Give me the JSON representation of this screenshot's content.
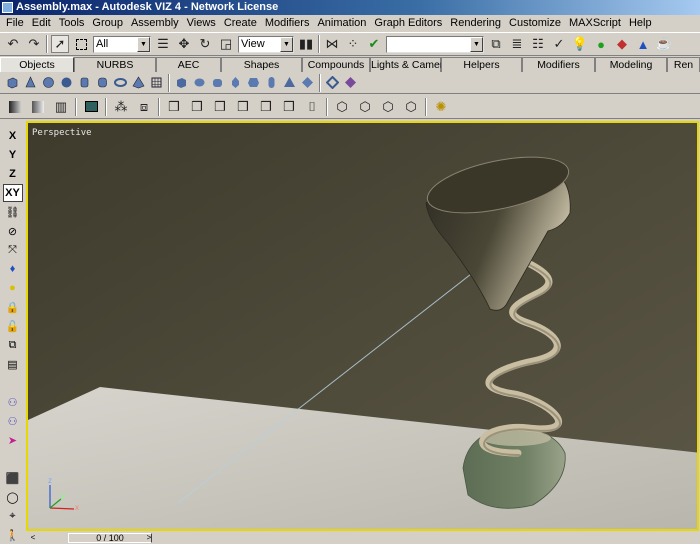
{
  "window": {
    "title": "Assembly.max - Autodesk VIZ 4 - Network License"
  },
  "menu": [
    "File",
    "Edit",
    "Tools",
    "Group",
    "Assembly",
    "Views",
    "Create",
    "Modifiers",
    "Animation",
    "Graph Editors",
    "Rendering",
    "Customize",
    "MAXScript",
    "Help"
  ],
  "toolbar": {
    "selection_filter": "All",
    "ref_coord": "View",
    "named_selection": ""
  },
  "tabs": [
    {
      "label": "Objects",
      "active": true
    },
    {
      "label": "NURBS"
    },
    {
      "label": "AEC"
    },
    {
      "label": "Shapes"
    },
    {
      "label": "Compounds"
    },
    {
      "label": "Lights & Cameras"
    },
    {
      "label": "Helpers"
    },
    {
      "label": "Modifiers"
    },
    {
      "label": "Modeling"
    },
    {
      "label": "Ren"
    }
  ],
  "axis_buttons": [
    "X",
    "Y",
    "Z",
    "XY"
  ],
  "viewport": {
    "label": "Perspective",
    "axis_x": "x",
    "axis_y": "y",
    "axis_z": "z"
  },
  "timeline": {
    "frame_display": "0 / 100",
    "prev": "<",
    "next": ">"
  },
  "colors": {
    "active_viewport_border": "#e8d800",
    "wall": "#4b4737",
    "floor": "#c9c7bd"
  }
}
